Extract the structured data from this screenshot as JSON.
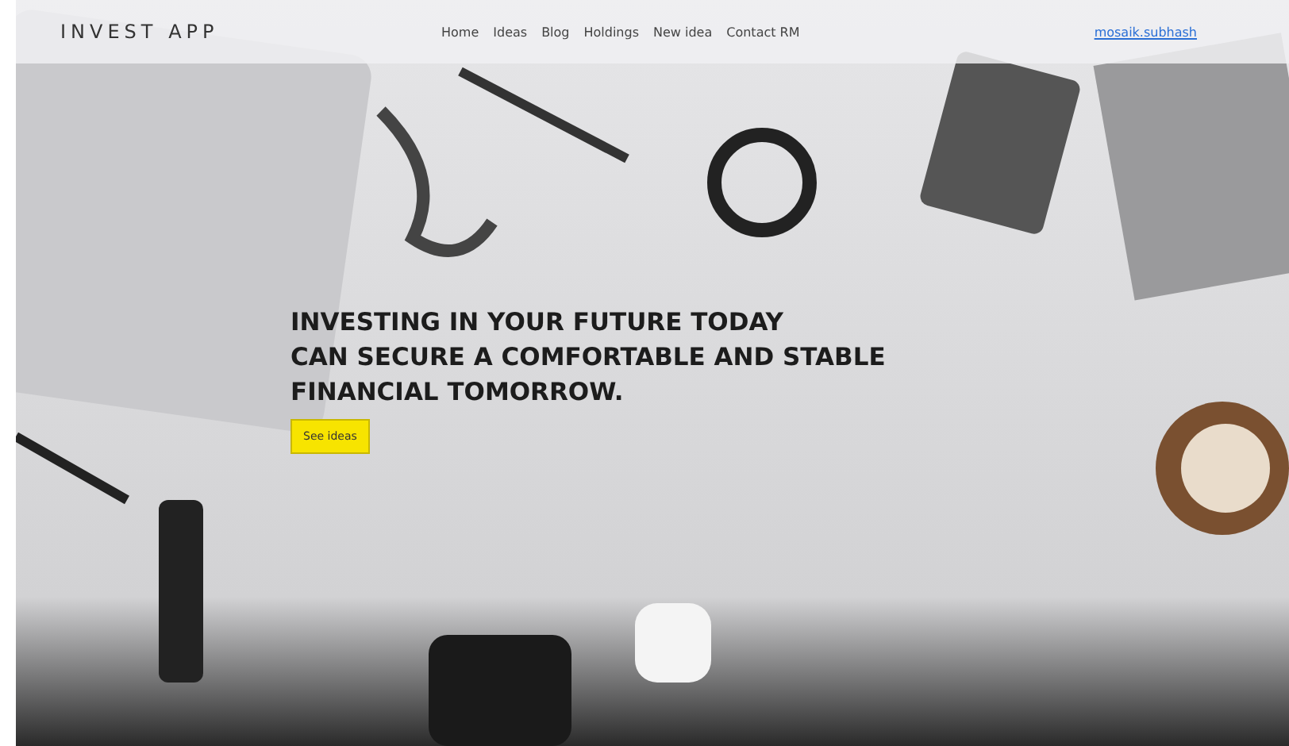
{
  "brand": "INVEST APP",
  "nav": [
    {
      "label": "Home",
      "selected": false
    },
    {
      "label": "Ideas",
      "selected": false
    },
    {
      "label": "Blog",
      "selected": false
    },
    {
      "label": "Holdings",
      "selected": false
    },
    {
      "label": "New idea",
      "selected": false
    },
    {
      "label": "Contact RM",
      "selected": false
    }
  ],
  "user_link": "mosaik.subhash",
  "hero": {
    "headline": [
      "INVESTING IN YOUR FUTURE TODAY",
      "CAN SECURE A COMFORTABLE AND STABLE",
      "FINANCIAL TOMORROW."
    ],
    "button": "See ideas"
  }
}
